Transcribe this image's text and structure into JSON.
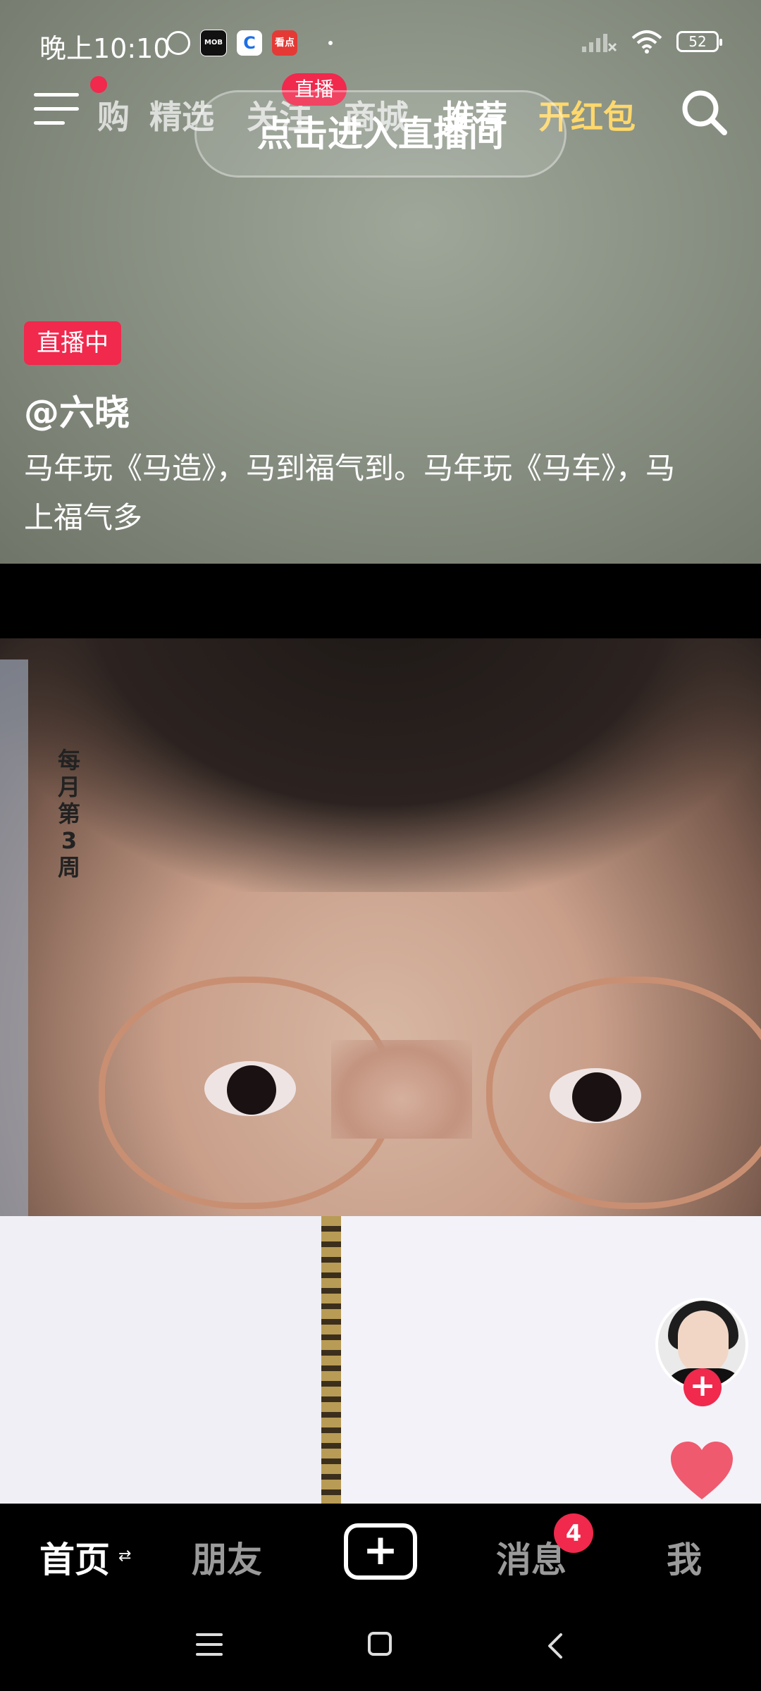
{
  "status_bar": {
    "time": "晚上10:10",
    "apps": [
      {
        "icon": "mob-app-icon",
        "label": "MOB",
        "bg": "#111111",
        "fg": "#ffffff"
      },
      {
        "icon": "browser-app-icon",
        "label": "C",
        "bg": "#ffffff",
        "fg": "#1f6fe5"
      },
      {
        "icon": "kandian-app-icon",
        "label": "看点",
        "bg": "#e53935",
        "fg": "#ffffff"
      }
    ],
    "battery": "52"
  },
  "top_nav": {
    "tabs": [
      {
        "label": "购",
        "active": false
      },
      {
        "label": "精选",
        "active": false
      },
      {
        "label": "关注",
        "active": false
      },
      {
        "label": "商城",
        "active": false
      },
      {
        "label": "推荐",
        "active": true
      },
      {
        "label": "开红包",
        "active": false
      }
    ],
    "live_badge": "直播",
    "enter_live_button": "点击进入直播间"
  },
  "live_card": {
    "tag": "直播中",
    "user": "@六晓",
    "description": "马年玩《马造》，马到福气到。马年玩《马车》，马上福气多"
  },
  "video": {
    "note_text": "每月第3周"
  },
  "tabbar": {
    "home": "首页",
    "friends": "朋友",
    "messages": "消息",
    "messages_badge": "4",
    "me": "我"
  },
  "colors": {
    "accent": "#f0294d",
    "red_packet": "#ffd86b"
  }
}
